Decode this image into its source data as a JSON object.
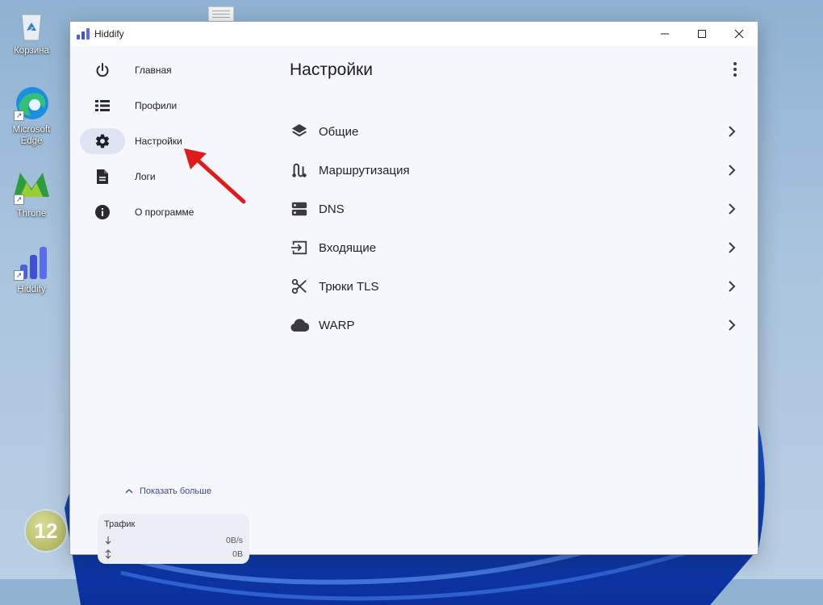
{
  "desktop": {
    "icons": [
      {
        "label": "Корзина",
        "icon": "recycle-bin-icon"
      },
      {
        "label": "Microsoft Edge",
        "icon": "edge-icon"
      },
      {
        "label": "Throne",
        "icon": "throne-icon"
      },
      {
        "label": "Hiddify",
        "icon": "hiddify-icon"
      }
    ],
    "badge": "12"
  },
  "window": {
    "title": "Hiddify",
    "controls": [
      "minimize",
      "maximize",
      "close"
    ]
  },
  "sidebar": {
    "items": [
      {
        "label": "Главная",
        "icon": "power-icon",
        "active": false
      },
      {
        "label": "Профили",
        "icon": "list-icon",
        "active": false
      },
      {
        "label": "Настройки",
        "icon": "gear-icon",
        "active": true
      },
      {
        "label": "Логи",
        "icon": "document-icon",
        "active": false
      },
      {
        "label": "О программе",
        "icon": "info-icon",
        "active": false
      }
    ],
    "show_more": "Показать больше",
    "traffic": {
      "title": "Трафик",
      "speed": "0B/s",
      "total": "0B"
    }
  },
  "main": {
    "title": "Настройки",
    "items": [
      {
        "label": "Общие",
        "icon": "layers-icon"
      },
      {
        "label": "Маршрутизация",
        "icon": "route-icon"
      },
      {
        "label": "DNS",
        "icon": "server-icon"
      },
      {
        "label": "Входящие",
        "icon": "inbound-icon"
      },
      {
        "label": "Трюки TLS",
        "icon": "scissors-icon"
      },
      {
        "label": "WARP",
        "icon": "cloud-icon"
      }
    ]
  },
  "colors": {
    "accent_active": "#dfe3f4",
    "annotation_arrow": "#e01b1b",
    "hiddify_blue": "#3f51d8"
  }
}
